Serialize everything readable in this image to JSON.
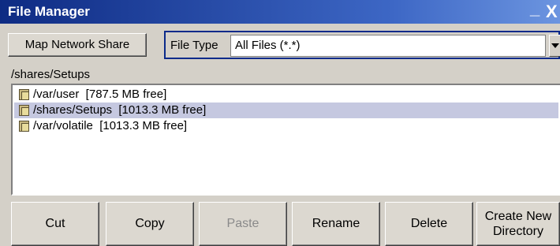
{
  "window": {
    "title": "File Manager",
    "minimize_glyph": "_",
    "close_glyph": "X"
  },
  "toolbar": {
    "map_network_share_label": "Map Network Share",
    "file_type_label": "File Type",
    "file_type_value": "All Files (*.*)"
  },
  "current_path": "/shares/Setups",
  "directories": [
    {
      "text": "/var/user  [787.5 MB free]",
      "selected": false,
      "icon": "folder-icon"
    },
    {
      "text": "/shares/Setups  [1013.3 MB free]",
      "selected": true,
      "icon": "folder-icon"
    },
    {
      "text": "/var/volatile  [1013.3 MB free]",
      "selected": false,
      "icon": "folder-icon"
    }
  ],
  "buttons": {
    "cut": "Cut",
    "copy": "Copy",
    "paste": "Paste",
    "rename": "Rename",
    "delete": "Delete",
    "create_new_directory_line1": "Create New",
    "create_new_directory_line2": "Directory"
  },
  "colors": {
    "title_bar": "#0e2b83",
    "selection": "#c5c8e0",
    "dialog_bg": "#d4d0c8"
  }
}
